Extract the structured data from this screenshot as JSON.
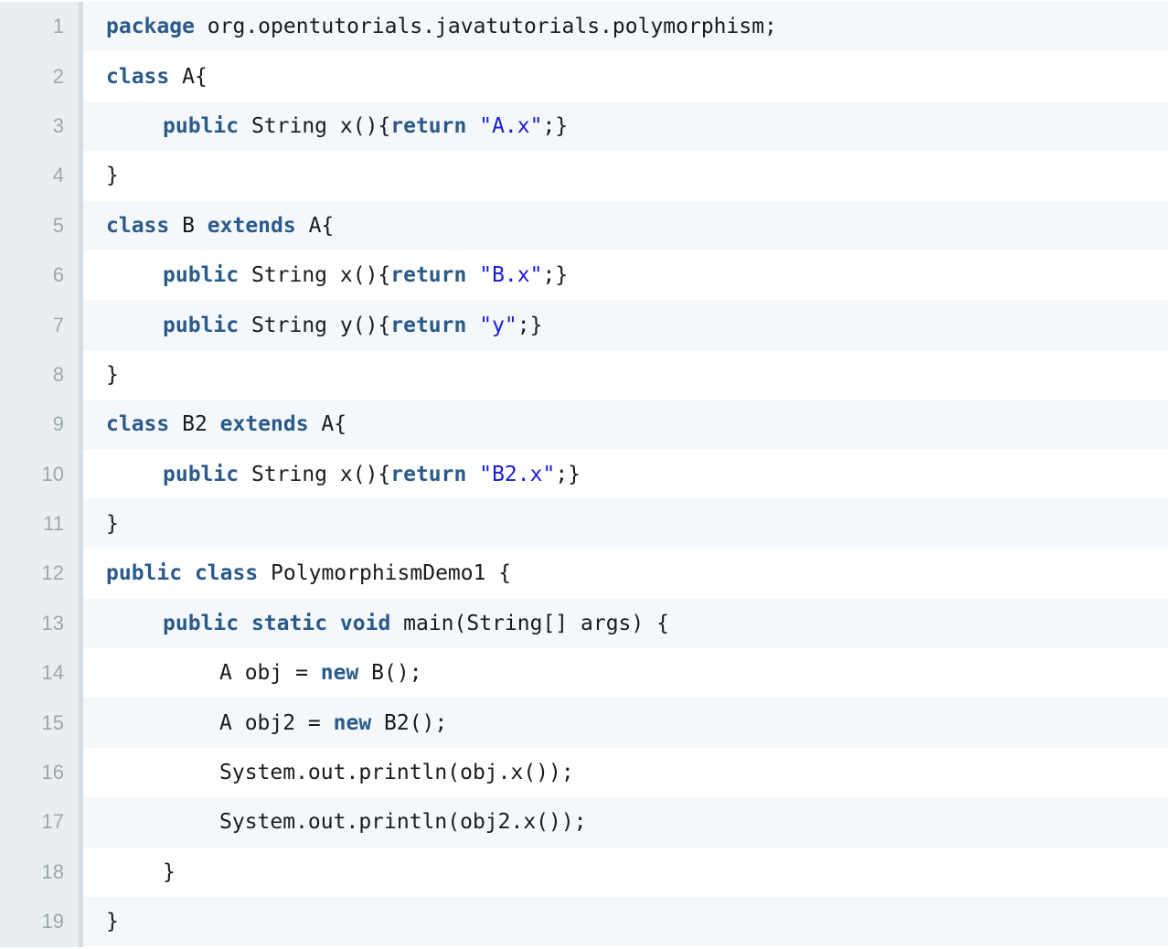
{
  "editor": {
    "language": "java",
    "colors": {
      "keyword": "#2a5a8a",
      "string": "#1a1ad8",
      "text": "#1a1a1a",
      "line_number": "#9ea7ad",
      "gutter": "#e9eef1",
      "stripe": "#f4f8fb"
    },
    "lines": [
      {
        "number": "1",
        "indent": 0,
        "tokens": [
          {
            "t": "kw",
            "v": "package"
          },
          {
            "t": "plain",
            "v": " org.opentutorials.javatutorials.polymorphism;"
          }
        ]
      },
      {
        "number": "2",
        "indent": 0,
        "tokens": [
          {
            "t": "kw",
            "v": "class"
          },
          {
            "t": "plain",
            "v": " A{"
          }
        ]
      },
      {
        "number": "3",
        "indent": 1,
        "tokens": [
          {
            "t": "kw",
            "v": "public"
          },
          {
            "t": "plain",
            "v": " String x(){"
          },
          {
            "t": "kw",
            "v": "return"
          },
          {
            "t": "plain",
            "v": " "
          },
          {
            "t": "str",
            "v": "\"A.x\""
          },
          {
            "t": "plain",
            "v": ";}"
          }
        ]
      },
      {
        "number": "4",
        "indent": 0,
        "tokens": [
          {
            "t": "plain",
            "v": "}"
          }
        ]
      },
      {
        "number": "5",
        "indent": 0,
        "tokens": [
          {
            "t": "kw",
            "v": "class"
          },
          {
            "t": "plain",
            "v": " B "
          },
          {
            "t": "kw",
            "v": "extends"
          },
          {
            "t": "plain",
            "v": " A{"
          }
        ]
      },
      {
        "number": "6",
        "indent": 1,
        "tokens": [
          {
            "t": "kw",
            "v": "public"
          },
          {
            "t": "plain",
            "v": " String x(){"
          },
          {
            "t": "kw",
            "v": "return"
          },
          {
            "t": "plain",
            "v": " "
          },
          {
            "t": "str",
            "v": "\"B.x\""
          },
          {
            "t": "plain",
            "v": ";}"
          }
        ]
      },
      {
        "number": "7",
        "indent": 1,
        "tokens": [
          {
            "t": "kw",
            "v": "public"
          },
          {
            "t": "plain",
            "v": " String y(){"
          },
          {
            "t": "kw",
            "v": "return"
          },
          {
            "t": "plain",
            "v": " "
          },
          {
            "t": "str",
            "v": "\"y\""
          },
          {
            "t": "plain",
            "v": ";}"
          }
        ]
      },
      {
        "number": "8",
        "indent": 0,
        "tokens": [
          {
            "t": "plain",
            "v": "}"
          }
        ]
      },
      {
        "number": "9",
        "indent": 0,
        "tokens": [
          {
            "t": "kw",
            "v": "class"
          },
          {
            "t": "plain",
            "v": " B2 "
          },
          {
            "t": "kw",
            "v": "extends"
          },
          {
            "t": "plain",
            "v": " A{"
          }
        ]
      },
      {
        "number": "10",
        "indent": 1,
        "tokens": [
          {
            "t": "kw",
            "v": "public"
          },
          {
            "t": "plain",
            "v": " String x(){"
          },
          {
            "t": "kw",
            "v": "return"
          },
          {
            "t": "plain",
            "v": " "
          },
          {
            "t": "str",
            "v": "\"B2.x\""
          },
          {
            "t": "plain",
            "v": ";}"
          }
        ]
      },
      {
        "number": "11",
        "indent": 0,
        "tokens": [
          {
            "t": "plain",
            "v": "}"
          }
        ]
      },
      {
        "number": "12",
        "indent": 0,
        "tokens": [
          {
            "t": "kw",
            "v": "public"
          },
          {
            "t": "plain",
            "v": " "
          },
          {
            "t": "kw",
            "v": "class"
          },
          {
            "t": "plain",
            "v": " PolymorphismDemo1 {"
          }
        ]
      },
      {
        "number": "13",
        "indent": 1,
        "tokens": [
          {
            "t": "kw",
            "v": "public"
          },
          {
            "t": "plain",
            "v": " "
          },
          {
            "t": "kw",
            "v": "static"
          },
          {
            "t": "plain",
            "v": " "
          },
          {
            "t": "kw",
            "v": "void"
          },
          {
            "t": "plain",
            "v": " main(String[] args) {"
          }
        ]
      },
      {
        "number": "14",
        "indent": 2,
        "tokens": [
          {
            "t": "plain",
            "v": "A obj = "
          },
          {
            "t": "kw",
            "v": "new"
          },
          {
            "t": "plain",
            "v": " B();"
          }
        ]
      },
      {
        "number": "15",
        "indent": 2,
        "tokens": [
          {
            "t": "plain",
            "v": "A obj2 = "
          },
          {
            "t": "kw",
            "v": "new"
          },
          {
            "t": "plain",
            "v": " B2();"
          }
        ]
      },
      {
        "number": "16",
        "indent": 2,
        "tokens": [
          {
            "t": "plain",
            "v": "System.out.println(obj.x());"
          }
        ]
      },
      {
        "number": "17",
        "indent": 2,
        "tokens": [
          {
            "t": "plain",
            "v": "System.out.println(obj2.x());"
          }
        ]
      },
      {
        "number": "18",
        "indent": 1,
        "tokens": [
          {
            "t": "plain",
            "v": "}"
          }
        ]
      },
      {
        "number": "19",
        "indent": 0,
        "tokens": [
          {
            "t": "plain",
            "v": "}"
          }
        ]
      }
    ]
  }
}
